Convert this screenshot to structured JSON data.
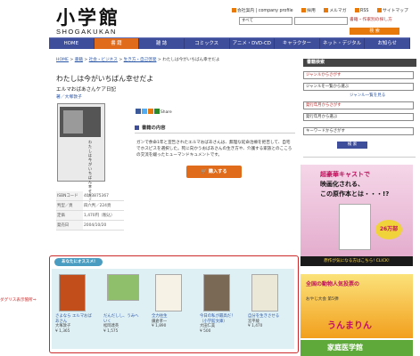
{
  "header": {
    "logo_jp": "小学館",
    "logo_en": "SHOGAKUKAN",
    "top_links": [
      "会社案内 | company profile",
      "採用",
      "メルマガ",
      "RSS",
      "サイトマップ"
    ],
    "search_scope": "すべて",
    "search_links": "書籍・作家別の探し方",
    "search_button": "検 索"
  },
  "nav": {
    "items": [
      "HOME",
      "書 籍",
      "雑 誌",
      "コミックス",
      "アニメ・DVD-CD",
      "キャラクター",
      "ネット・デジタル",
      "お知らせ"
    ],
    "active_index": 1
  },
  "breadcrumb": {
    "items": [
      "HOME",
      "書籍",
      "社会・ビジネス",
      "生き方・自己啓発"
    ],
    "current": "わたしは今がいちばん幸せだよ",
    "separator": " > "
  },
  "book": {
    "title": "わたしは今がいちばん幸せだよ",
    "subtitle": "エルマおばあさんケア日記",
    "author_label": "著／大塚敦子",
    "cover_vertical_text": "わたしは今がいちばん幸せだよ",
    "share_label": "Share",
    "section_title": "書籍の内容",
    "description": "ガンで余命1年と宣告されたエルマおばあさんは、無理な延命治療を拒否して、自宅でホスピスを選択した。死に向かうおばあさんの生き方や、介護する家族とのこころの交流を綴ったヒューマンドキュメントです。",
    "buy_button": "購入する",
    "specs": [
      {
        "k": "ISBNコード",
        "v": "4093875367"
      },
      {
        "k": "判型／頁",
        "v": "四六判／224頁"
      },
      {
        "k": "定価",
        "v": "1,470円（税込）"
      },
      {
        "k": "発売日",
        "v": "2004/10/20"
      }
    ]
  },
  "recommend": {
    "label": "あなたにオススメ!",
    "annotation": "ダグリス表示箇所⇒",
    "items": [
      {
        "title": "さよなら エルマおばあさん",
        "author": "大塚敦子",
        "price": "¥ 1,365"
      },
      {
        "title": "だんだしし、うみへ いく",
        "author": "松岡達英",
        "price": "¥ 1,575"
      },
      {
        "title": "全力往生",
        "author": "鎌倉孝一",
        "price": "¥ 1,890"
      },
      {
        "title": "今日の私が最高だ！（小学館文庫）",
        "author": "大田仁美",
        "price": "¥ 500"
      },
      {
        "title": "自分を生きさせる",
        "author": "宮平綾",
        "price": "¥ 1,470"
      }
    ]
  },
  "sidebar": {
    "title": "書籍検索",
    "fields": [
      "ジャンルからさがす",
      "ジャンルを一覧から選ぶ",
      "発行年月からさがす",
      "発行年月から選ぶ",
      "キーワードからさがす"
    ],
    "link": "ジャンル一覧を見る",
    "search_button": "検 索"
  },
  "ads": {
    "ad1_l1": "超豪華キャストで",
    "ad1_l2": "映画化される、",
    "ad1_l3": "この原作本とは・・・!?",
    "ad1_burst": "26万部",
    "ad1_footer": "原作が気になる方はこちら! CLICK!",
    "ad2_l1": "全国の動物人気投票の",
    "ad2_l2": "おやじ大会 第5弾",
    "ad2_l3": "うんまりん",
    "ad3_title": "家庭医学館"
  },
  "colors": {
    "nav_bg": "#3f4e9a",
    "accent_orange": "#e06c1b",
    "rec_border": "#cc2a2a"
  }
}
